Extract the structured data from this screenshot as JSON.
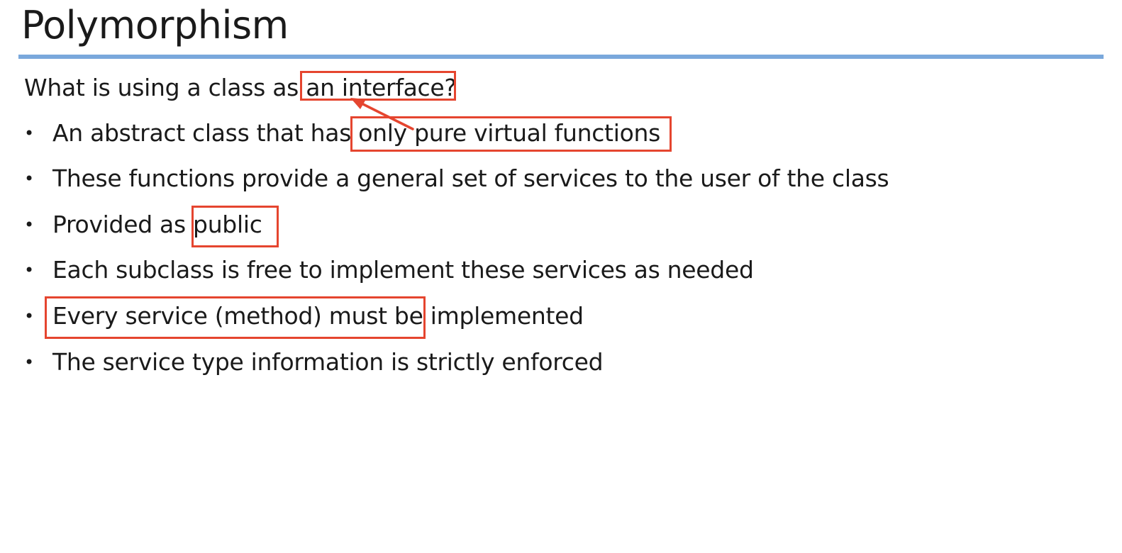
{
  "slide": {
    "title": "Polymorphism",
    "question": "What is using a class as an interface?",
    "bullets": [
      "An abstract class that has only pure virtual functions",
      "These functions provide a general set of services to the user of the class",
      "Provided as public",
      "Each subclass is free to implement these services as needed",
      "Every service (method) must be implemented",
      "The service type information is strictly enforced"
    ],
    "bullet_symbol": "•"
  },
  "colors": {
    "title_rule": "#7aa8dc",
    "annotation": "#e5452f"
  }
}
